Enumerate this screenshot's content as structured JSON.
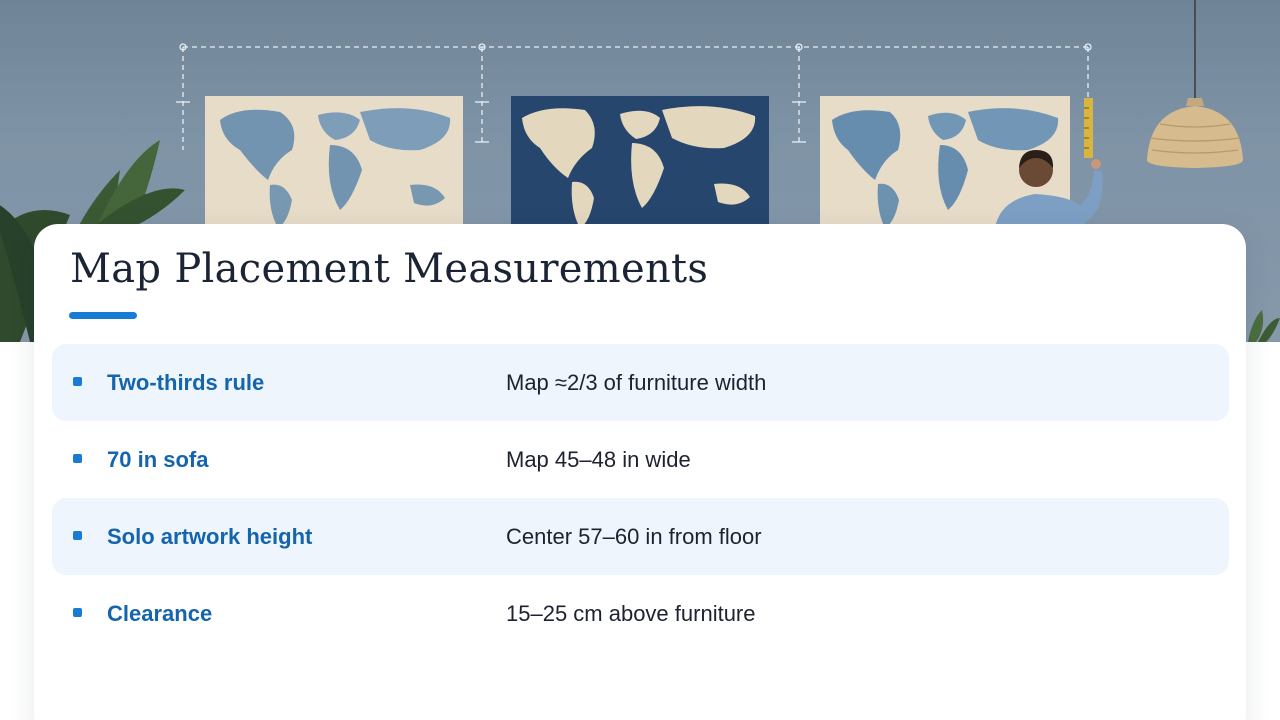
{
  "slide": {
    "title": "Map Placement Measurements",
    "colors": {
      "accent": "#1a7bd4",
      "label": "#1565ad",
      "row_shade": "#eef5fd",
      "text": "#1e2230",
      "wall": "#7f93a6"
    },
    "hero_image": {
      "icons": [
        "plant-icon",
        "world-map-icon",
        "pendant-lamp-icon",
        "person-icon",
        "tape-measure-icon"
      ]
    },
    "rows": [
      {
        "label": "Two-thirds rule",
        "value": "Map ≈2/3 of furniture width"
      },
      {
        "label": "70 in sofa",
        "value": "Map 45–48 in wide"
      },
      {
        "label": "Solo artwork height",
        "value": "Center 57–60 in from floor"
      },
      {
        "label": "Clearance",
        "value": "15–25 cm above furniture"
      }
    ]
  }
}
